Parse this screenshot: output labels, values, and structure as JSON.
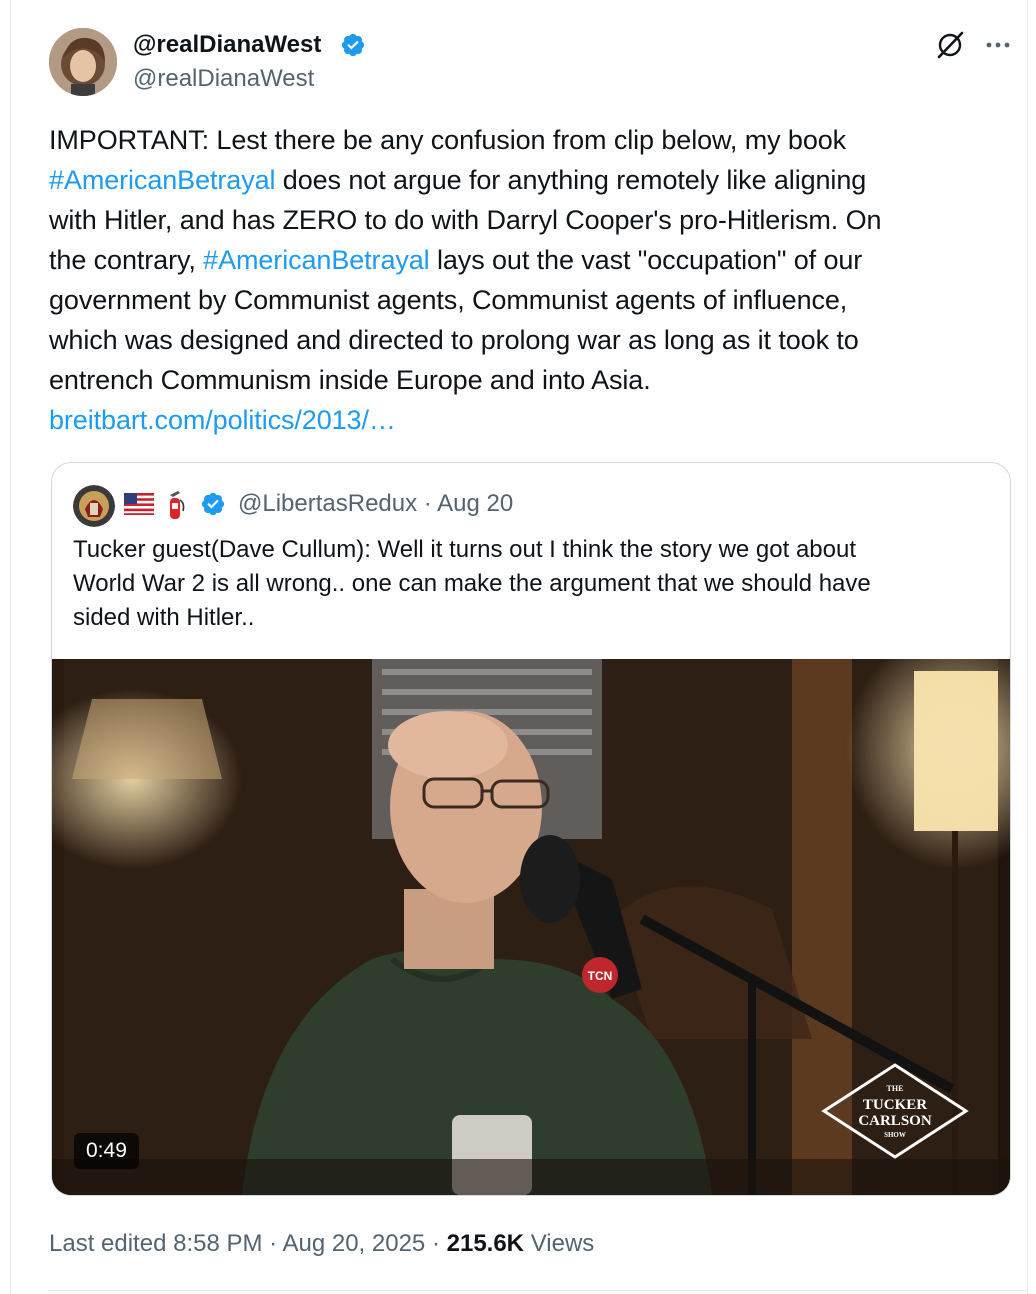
{
  "author": {
    "display_name": "@realDianaWest",
    "handle": "@realDianaWest"
  },
  "tweet": {
    "lines": [
      [
        {
          "t": "IMPORTANT: Lest there be any confusion from clip below, my book"
        }
      ],
      [
        {
          "t": "#AmericanBetrayal",
          "link": true
        },
        {
          "t": " does not argue for anything remotely like aligning"
        }
      ],
      [
        {
          "t": "with Hitler, and has ZERO to do with Darryl Cooper's pro-Hitlerism. On"
        }
      ],
      [
        {
          "t": "the contrary, "
        },
        {
          "t": "#AmericanBetrayal",
          "link": true
        },
        {
          "t": " lays out the vast \"occupation\" of our"
        }
      ],
      [
        {
          "t": "government by Communist agents, Communist agents of influence,"
        }
      ],
      [
        {
          "t": "which was designed and directed to prolong war as long as it took  to"
        }
      ],
      [
        {
          "t": "entrench Communism inside Europe and into Asia."
        }
      ],
      [
        {
          "t": "breitbart.com/politics/2013/…",
          "link": true
        }
      ]
    ]
  },
  "quote": {
    "handle": "@LibertasRedux",
    "separator": "·",
    "date": "Aug 20",
    "lines": [
      "Tucker guest(Dave Cullum): Well it turns out I think the story we got about",
      "World War 2 is all wrong.. one can make the argument that we should have",
      "sided with Hitler.."
    ],
    "video": {
      "duration": "0:49",
      "mic_label": "TCN",
      "watermark": [
        "THE",
        "TUCKER",
        "CARLSON",
        "SHOW"
      ]
    }
  },
  "meta": {
    "edited": "Last edited 8:58 PM",
    "sep1": "·",
    "date": "Aug 20, 2025",
    "sep2": "·",
    "views_count": "215.6K",
    "views_label": "Views"
  },
  "colors": {
    "link": "#1d9bf0",
    "verified": "#1d9bf0",
    "secondary": "#536471",
    "primary": "#0f1419"
  },
  "icons": [
    "verified-badge-icon",
    "grok-icon",
    "more-icon",
    "us-flag-icon",
    "fire-extinguisher-icon"
  ]
}
